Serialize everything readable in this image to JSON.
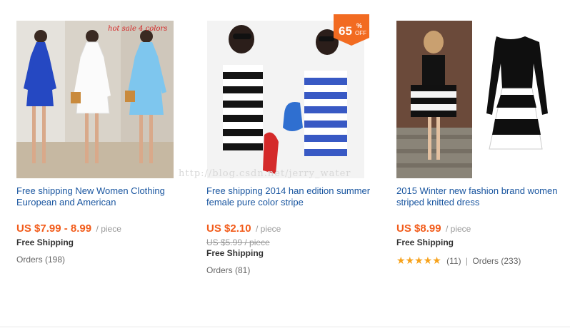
{
  "products": [
    {
      "title": "Free shipping New Women Clothing European and American",
      "image_overlay": "hot sale 4 colors",
      "price": "US $7.99 - 8.99",
      "unit": "/ piece",
      "shipping": "Free Shipping",
      "orders": "Orders (198)"
    },
    {
      "title": "Free shipping 2014 han edition summer female pure color stripe",
      "sale_badge": {
        "value": "65",
        "percent": "%",
        "off": "OFF"
      },
      "price": "US $2.10",
      "unit": "/ piece",
      "old_price": "US $5.99 / piece",
      "shipping": "Free Shipping",
      "orders": "Orders (81)"
    },
    {
      "title": "2015 Winter new fashion brand women striped knitted dress",
      "price": "US $8.99",
      "unit": "/ piece",
      "shipping": "Free Shipping",
      "rating": 5,
      "stars": "★★★★★",
      "reviews": "(11)",
      "separator": "|",
      "orders": "Orders (233)"
    }
  ],
  "watermark": "http://blog.csdn.net/jerry_water",
  "colors": {
    "price": "#f25c1b",
    "link": "#1a56a0",
    "badge": "#f26b21",
    "stars": "#f7a21b"
  }
}
